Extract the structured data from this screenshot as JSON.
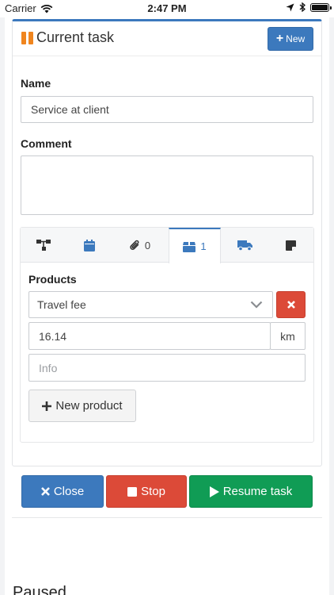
{
  "status_bar": {
    "carrier": "Carrier",
    "time": "2:47 PM"
  },
  "task": {
    "title": "Current task",
    "new_label": "New",
    "name_label": "Name",
    "name_value": "Service at client",
    "comment_label": "Comment",
    "comment_value": ""
  },
  "tabs": [
    {
      "icon": "sitemap-icon",
      "count": ""
    },
    {
      "icon": "calendar-icon",
      "count": ""
    },
    {
      "icon": "paperclip-icon",
      "count": "0"
    },
    {
      "icon": "box-icon",
      "count": "1",
      "active": true
    },
    {
      "icon": "truck-icon",
      "count": ""
    },
    {
      "icon": "note-icon",
      "count": ""
    }
  ],
  "products": {
    "heading": "Products",
    "selected_product": "Travel fee",
    "quantity": "16.14",
    "unit": "km",
    "info_placeholder": "Info",
    "new_product_label": "New product"
  },
  "actions": {
    "close_label": "Close",
    "stop_label": "Stop",
    "resume_label": "Resume task"
  },
  "footer": {
    "status": "Paused"
  },
  "colors": {
    "primary": "#3c79bd",
    "danger": "#dc4a38",
    "success": "#109c55",
    "paused": "#f0851e"
  }
}
